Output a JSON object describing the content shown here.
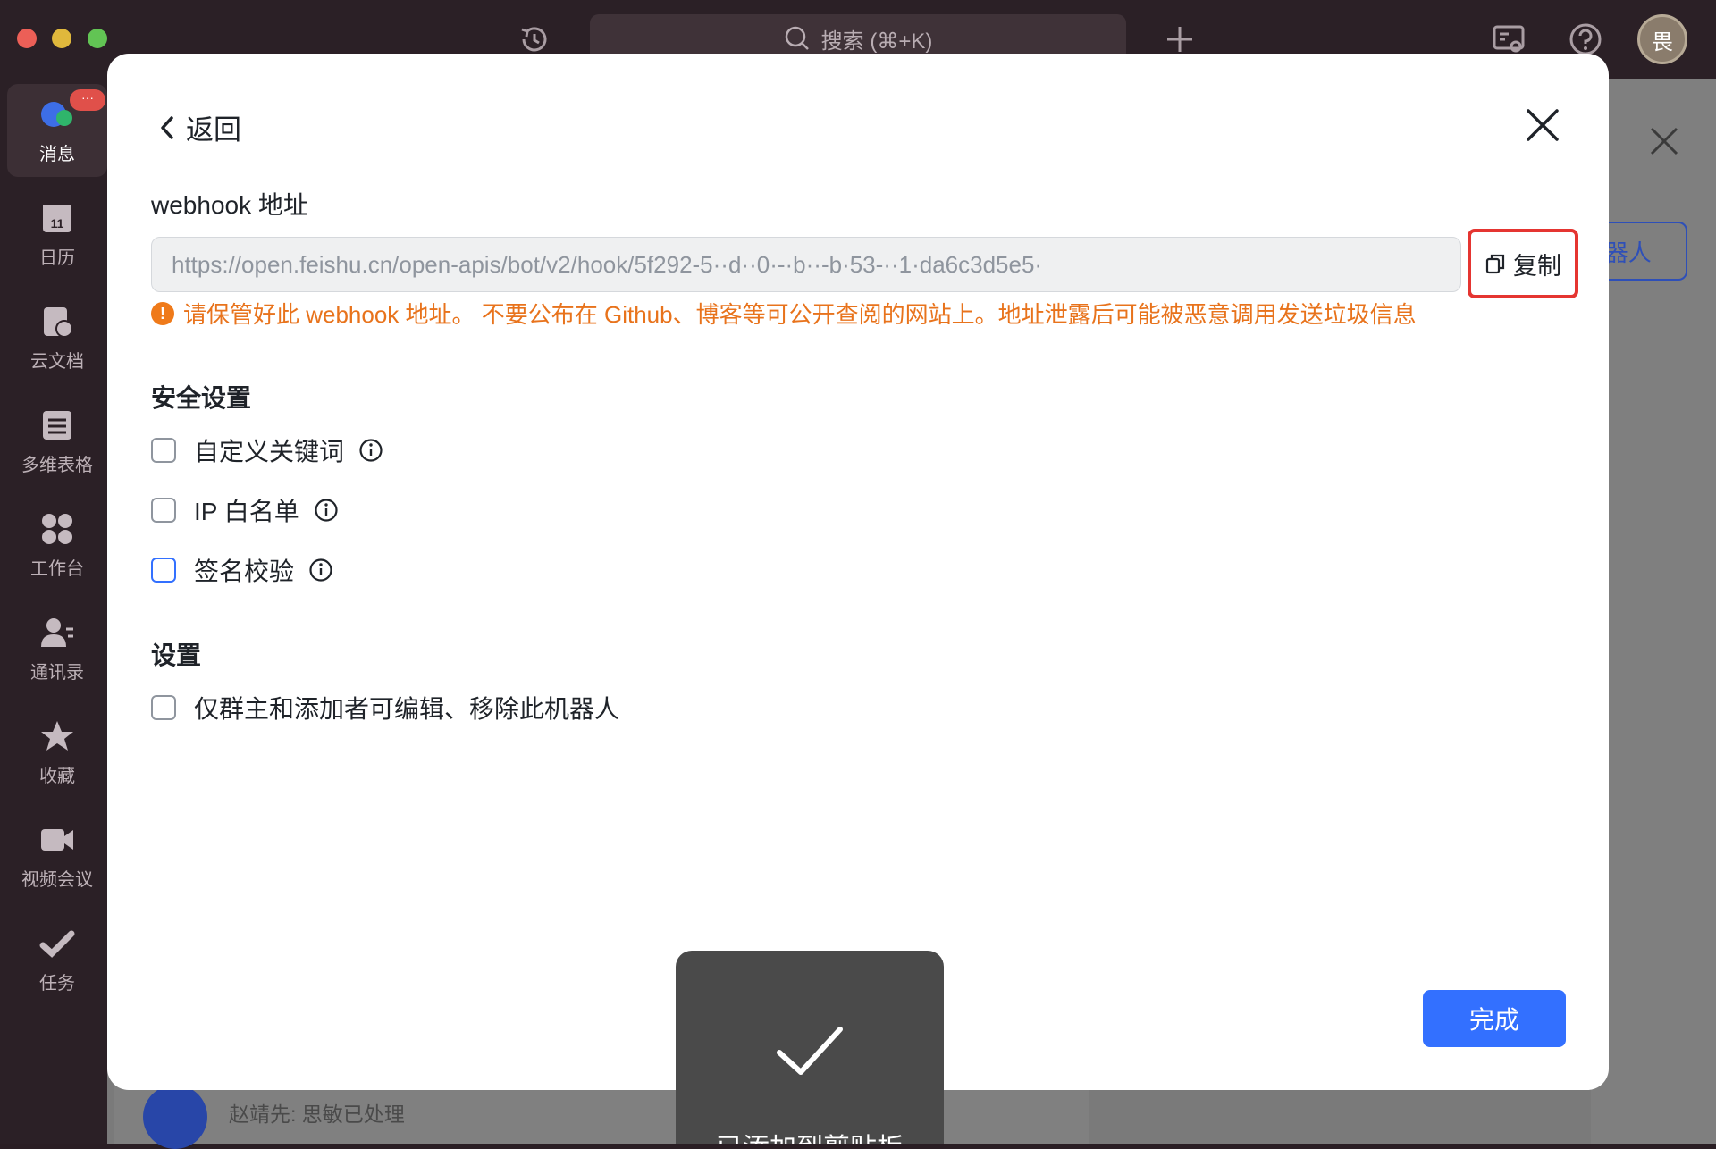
{
  "topbar": {
    "search_placeholder": "搜索 (⌘+K)",
    "avatar_text": "畏"
  },
  "sidebar": {
    "items": [
      {
        "label": "消息",
        "icon": "chat-icon",
        "badge": "···"
      },
      {
        "label": "日历",
        "icon": "calendar-icon",
        "day": "11"
      },
      {
        "label": "云文档",
        "icon": "cloud-doc-icon"
      },
      {
        "label": "多维表格",
        "icon": "bitable-icon"
      },
      {
        "label": "工作台",
        "icon": "workplace-icon"
      },
      {
        "label": "通讯录",
        "icon": "contacts-icon"
      },
      {
        "label": "收藏",
        "icon": "star-icon"
      },
      {
        "label": "视频会议",
        "icon": "video-icon"
      },
      {
        "label": "任务",
        "icon": "task-icon"
      }
    ]
  },
  "background": {
    "right_button_label": "l器人",
    "bottom_message": "赵靖先: 思敏已处理"
  },
  "modal": {
    "back_label": "返回",
    "webhook_label": "webhook 地址",
    "webhook_url": "https://open.feishu.cn/open-apis/bot/v2/hook/5f292-5··d··0·-·b··-b·53-··1·da6c3d5e5·",
    "copy_label": "复制",
    "warning": "请保管好此 webhook 地址。 不要公布在 Github、博客等可公开查阅的网站上。地址泄露后可能被恶意调用发送垃圾信息",
    "security_title": "安全设置",
    "security_options": [
      {
        "label": "自定义关键词",
        "checked": false
      },
      {
        "label": "IP 白名单",
        "checked": false
      },
      {
        "label": "签名校验",
        "checked": false
      }
    ],
    "settings_title": "设置",
    "settings_option": "仅群主和添加者可编辑、移除此机器人",
    "done_label": "完成"
  },
  "toast": {
    "text": "已添加到剪贴板"
  },
  "colors": {
    "primary": "#3370ff",
    "warning": "#e8731c",
    "highlight_border": "#e53531"
  }
}
